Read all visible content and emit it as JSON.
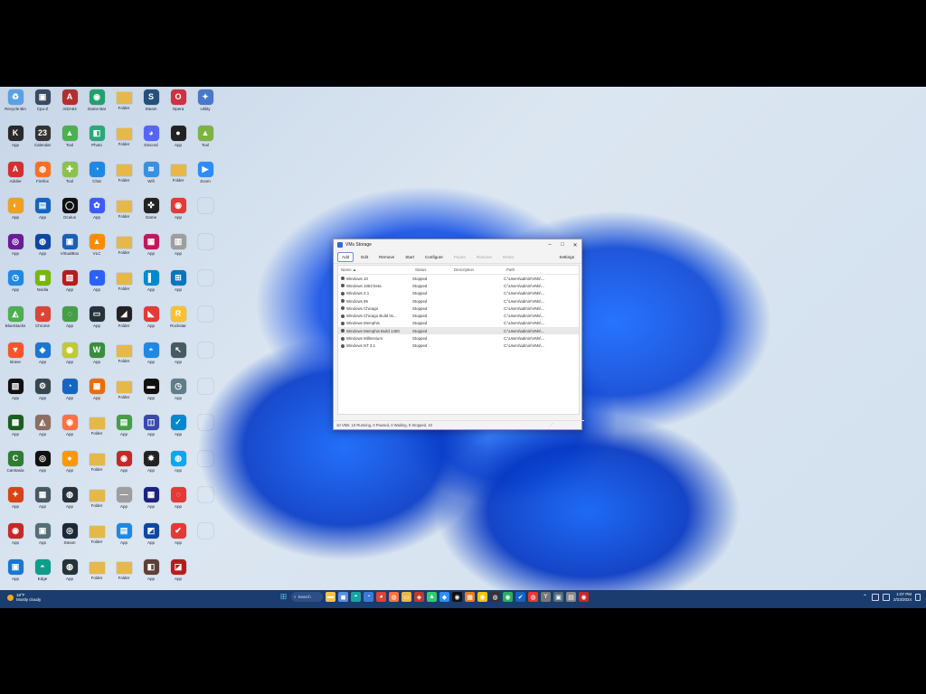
{
  "desktop": {
    "icons": [
      {
        "label": "Recycle Bin",
        "color": "#5aa0e6",
        "glyph": "♻"
      },
      {
        "label": "Cpu-Z",
        "color": "#3a4a60",
        "glyph": "▣"
      },
      {
        "label": "AIDA64",
        "color": "#b03030",
        "glyph": "A"
      },
      {
        "label": "Game Bar",
        "color": "#22a06b",
        "glyph": "◉"
      },
      {
        "label": "Folder",
        "color": "#e6b84a",
        "glyph": ""
      },
      {
        "label": "Steam",
        "color": "#24507a",
        "glyph": "S"
      },
      {
        "label": "Opera",
        "color": "#d03040",
        "glyph": "O"
      },
      {
        "label": "Utility",
        "color": "#4a78c8",
        "glyph": "✦"
      },
      {
        "label": "App",
        "color": "#2a2a2a",
        "glyph": "K"
      },
      {
        "label": "Calendar",
        "color": "#333",
        "glyph": "23"
      },
      {
        "label": "Tool",
        "color": "#4caf50",
        "glyph": "▲"
      },
      {
        "label": "Photo",
        "color": "#2aa878",
        "glyph": "◧"
      },
      {
        "label": "Folder",
        "color": "#e6b84a",
        "glyph": ""
      },
      {
        "label": "Discord",
        "color": "#5865f2",
        "glyph": "◕"
      },
      {
        "label": "App",
        "color": "#222",
        "glyph": "●"
      },
      {
        "label": "Tool",
        "color": "#7cb342",
        "glyph": "▲"
      },
      {
        "label": "Adobe",
        "color": "#d32f2f",
        "glyph": "A"
      },
      {
        "label": "Firefox",
        "color": "#ff6f1f",
        "glyph": "◍"
      },
      {
        "label": "Tool",
        "color": "#8bc34a",
        "glyph": "✚"
      },
      {
        "label": "Chat",
        "color": "#1e88e5",
        "glyph": "◔"
      },
      {
        "label": "Folder",
        "color": "#e6b84a",
        "glyph": ""
      },
      {
        "label": "Wifi",
        "color": "#3a90e0",
        "glyph": "≋"
      },
      {
        "label": "Folder",
        "color": "#e6b84a",
        "glyph": ""
      },
      {
        "label": "Zoom",
        "color": "#2d8cff",
        "glyph": "▶"
      },
      {
        "label": "App",
        "color": "#f0a020",
        "glyph": "◐"
      },
      {
        "label": "App",
        "color": "#1565c0",
        "glyph": "▤"
      },
      {
        "label": "Oculus",
        "color": "#111",
        "glyph": "◯"
      },
      {
        "label": "App",
        "color": "#3d5afe",
        "glyph": "✿"
      },
      {
        "label": "Folder",
        "color": "#e6b84a",
        "glyph": ""
      },
      {
        "label": "Game",
        "color": "#222",
        "glyph": "✜"
      },
      {
        "label": "App",
        "color": "#e53935",
        "glyph": "◉"
      },
      {
        "label": "",
        "color": "rgba(0,0,0,0)",
        "glyph": ""
      },
      {
        "label": "App",
        "color": "#6a1b9a",
        "glyph": "◎"
      },
      {
        "label": "App",
        "color": "#0d47a1",
        "glyph": "◍"
      },
      {
        "label": "VirtualBox",
        "color": "#1a5fb4",
        "glyph": "▣"
      },
      {
        "label": "VLC",
        "color": "#ff8c00",
        "glyph": "▲"
      },
      {
        "label": "Folder",
        "color": "#e6b84a",
        "glyph": ""
      },
      {
        "label": "App",
        "color": "#c2185b",
        "glyph": "▦"
      },
      {
        "label": "App",
        "color": "#9e9e9e",
        "glyph": "▥"
      },
      {
        "label": "",
        "color": "rgba(0,0,0,0)",
        "glyph": ""
      },
      {
        "label": "App",
        "color": "#1e88e5",
        "glyph": "◷"
      },
      {
        "label": "Nvidia",
        "color": "#76b900",
        "glyph": "◼"
      },
      {
        "label": "App",
        "color": "#b71c1c",
        "glyph": "▧"
      },
      {
        "label": "App",
        "color": "#2962ff",
        "glyph": "▪"
      },
      {
        "label": "Folder",
        "color": "#e6b84a",
        "glyph": ""
      },
      {
        "label": "App",
        "color": "#0288d1",
        "glyph": "▌"
      },
      {
        "label": "App",
        "color": "#0277bd",
        "glyph": "⊞"
      },
      {
        "label": "",
        "color": "rgba(0,0,0,0)",
        "glyph": ""
      },
      {
        "label": "BlueStacks",
        "color": "#4caf50",
        "glyph": "◭"
      },
      {
        "label": "Chrome",
        "color": "#db4437",
        "glyph": "◕"
      },
      {
        "label": "App",
        "color": "#43a047",
        "glyph": "◌"
      },
      {
        "label": "App",
        "color": "#263238",
        "glyph": "▭"
      },
      {
        "label": "Folder",
        "color": "#222",
        "glyph": "◢"
      },
      {
        "label": "App",
        "color": "#e53935",
        "glyph": "◣"
      },
      {
        "label": "Rockstar",
        "color": "#fbc02d",
        "glyph": "R"
      },
      {
        "label": "",
        "color": "rgba(0,0,0,0)",
        "glyph": ""
      },
      {
        "label": "Brave",
        "color": "#fb542b",
        "glyph": "▼"
      },
      {
        "label": "App",
        "color": "#1976d2",
        "glyph": "◈"
      },
      {
        "label": "App",
        "color": "#c0ca33",
        "glyph": "◉"
      },
      {
        "label": "App",
        "color": "#388e3c",
        "glyph": "W"
      },
      {
        "label": "Folder",
        "color": "#e6b84a",
        "glyph": ""
      },
      {
        "label": "App",
        "color": "#1e88e5",
        "glyph": "◓"
      },
      {
        "label": "App",
        "color": "#455a64",
        "glyph": "↖"
      },
      {
        "label": "",
        "color": "rgba(0,0,0,0)",
        "glyph": ""
      },
      {
        "label": "App",
        "color": "#111",
        "glyph": "▧"
      },
      {
        "label": "App",
        "color": "#37474f",
        "glyph": "⚙"
      },
      {
        "label": "App",
        "color": "#1565c0",
        "glyph": "◔"
      },
      {
        "label": "App",
        "color": "#ef6c00",
        "glyph": "▩"
      },
      {
        "label": "Folder",
        "color": "#e6b84a",
        "glyph": ""
      },
      {
        "label": "App",
        "color": "#111",
        "glyph": "▬"
      },
      {
        "label": "App",
        "color": "#607d8b",
        "glyph": "◷"
      },
      {
        "label": "",
        "color": "rgba(0,0,0,0)",
        "glyph": ""
      },
      {
        "label": "App",
        "color": "#1b5e20",
        "glyph": "▩"
      },
      {
        "label": "App",
        "color": "#8d6e63",
        "glyph": "◭"
      },
      {
        "label": "App",
        "color": "#ff7043",
        "glyph": "◉"
      },
      {
        "label": "Folder",
        "color": "#e6b84a",
        "glyph": ""
      },
      {
        "label": "App",
        "color": "#43a047",
        "glyph": "▤"
      },
      {
        "label": "App",
        "color": "#3949ab",
        "glyph": "◫"
      },
      {
        "label": "App",
        "color": "#0288d1",
        "glyph": "✓"
      },
      {
        "label": "",
        "color": "rgba(0,0,0,0)",
        "glyph": ""
      },
      {
        "label": "Camtasia",
        "color": "#2e7d32",
        "glyph": "C"
      },
      {
        "label": "App",
        "color": "#111",
        "glyph": "◎"
      },
      {
        "label": "App",
        "color": "#ff9800",
        "glyph": "●"
      },
      {
        "label": "Folder",
        "color": "#e6b84a",
        "glyph": ""
      },
      {
        "label": "App",
        "color": "#c62828",
        "glyph": "◉"
      },
      {
        "label": "App",
        "color": "#222",
        "glyph": "✸"
      },
      {
        "label": "App",
        "color": "#03a9f4",
        "glyph": "◍"
      },
      {
        "label": "",
        "color": "rgba(0,0,0,0)",
        "glyph": ""
      },
      {
        "label": "App",
        "color": "#d84315",
        "glyph": "✦"
      },
      {
        "label": "App",
        "color": "#455a64",
        "glyph": "▦"
      },
      {
        "label": "App",
        "color": "#263238",
        "glyph": "◍"
      },
      {
        "label": "Folder",
        "color": "#e6b84a",
        "glyph": ""
      },
      {
        "label": "App",
        "color": "#9e9e9e",
        "glyph": "—"
      },
      {
        "label": "App",
        "color": "#1a237e",
        "glyph": "▦"
      },
      {
        "label": "App",
        "color": "#e53935",
        "glyph": "◌"
      },
      {
        "label": "",
        "color": "rgba(0,0,0,0)",
        "glyph": ""
      },
      {
        "label": "App",
        "color": "#c62828",
        "glyph": "◉"
      },
      {
        "label": "App",
        "color": "#546e7a",
        "glyph": "▣"
      },
      {
        "label": "Steam",
        "color": "#1b2838",
        "glyph": "◎"
      },
      {
        "label": "Folder",
        "color": "#e6b84a",
        "glyph": ""
      },
      {
        "label": "App",
        "color": "#1e88e5",
        "glyph": "▤"
      },
      {
        "label": "App",
        "color": "#0d47a1",
        "glyph": "◩"
      },
      {
        "label": "App",
        "color": "#e53935",
        "glyph": "✔"
      },
      {
        "label": "",
        "color": "rgba(0,0,0,0)",
        "glyph": ""
      },
      {
        "label": "App",
        "color": "#1976d2",
        "glyph": "▣"
      },
      {
        "label": "Edge",
        "color": "#0f9d8a",
        "glyph": "◓"
      },
      {
        "label": "App",
        "color": "#263238",
        "glyph": "◍"
      },
      {
        "label": "Folder",
        "color": "#e6b84a",
        "glyph": ""
      },
      {
        "label": "Folder",
        "color": "#e6b84a",
        "glyph": ""
      },
      {
        "label": "App",
        "color": "#5d4037",
        "glyph": "◧"
      },
      {
        "label": "App",
        "color": "#b71c1c",
        "glyph": "◪"
      }
    ]
  },
  "window": {
    "title": "VMs Storage",
    "minimize": "–",
    "maximize": "□",
    "close": "✕",
    "toolbar": {
      "add": "Add",
      "edit": "Edit",
      "remove": "Remove",
      "start": "Start",
      "configure": "Configure",
      "pause": "Pause",
      "resume": "Resume",
      "reset": "Reset",
      "settings": "Settings"
    },
    "columns": {
      "name": "Name ▲",
      "status": "Status",
      "description": "Description",
      "path": "Path"
    },
    "rows": [
      {
        "name": "Windows 10",
        "status": "Stopped",
        "path": "C:\\Users\\admin\\VMs\\..."
      },
      {
        "name": "Windows 1063 beta",
        "status": "Stopped",
        "path": "C:\\Users\\admin\\VMs\\..."
      },
      {
        "name": "Windows 3.1",
        "status": "Stopped",
        "path": "C:\\Users\\admin\\VMs\\..."
      },
      {
        "name": "Windows 95",
        "status": "Stopped",
        "path": "C:\\Users\\admin\\VMs\\..."
      },
      {
        "name": "Windows Chicago",
        "status": "Stopped",
        "path": "C:\\Users\\admin\\VMs\\..."
      },
      {
        "name": "Windows Chicago Build 0x...",
        "status": "Stopped",
        "path": "C:\\Users\\admin\\VMs\\..."
      },
      {
        "name": "Windows Memphis",
        "status": "Stopped",
        "path": "C:\\Users\\admin\\VMs\\..."
      },
      {
        "name": "Windows Memphis Build 1400",
        "status": "Stopped",
        "path": "C:\\Users\\admin\\VMs\\...",
        "highlight": true
      },
      {
        "name": "Windows Millennium",
        "status": "Stopped",
        "path": "C:\\Users\\admin\\VMs\\..."
      },
      {
        "name": "Windows NT 3.1",
        "status": "Stopped",
        "path": "C:\\Users\\admin\\VMs\\..."
      }
    ],
    "status_bar": "10 VMs: 10 Running, 0 Paused, 0 Waiting, 0 Stopped, 10",
    "resize_grip": "⋰"
  },
  "taskbar": {
    "weather_temp": "18°F",
    "weather_desc": "Mostly cloudy",
    "search_label": "Search",
    "apps": [
      {
        "name": "files",
        "color": "#f6c343",
        "glyph": "▬"
      },
      {
        "name": "app",
        "color": "#5a8fe0",
        "glyph": "◼"
      },
      {
        "name": "edge",
        "color": "#1aa3a3",
        "glyph": "◓"
      },
      {
        "name": "app",
        "color": "#3a7bd5",
        "glyph": "◔"
      },
      {
        "name": "chrome",
        "color": "#db4437",
        "glyph": "◕"
      },
      {
        "name": "firefox",
        "color": "#ff7139",
        "glyph": "◍"
      },
      {
        "name": "explorer",
        "color": "#e6b84a",
        "glyph": "▭"
      },
      {
        "name": "app",
        "color": "#c0392b",
        "glyph": "◈"
      },
      {
        "name": "app",
        "color": "#2ecc71",
        "glyph": "▲"
      },
      {
        "name": "app",
        "color": "#2d8cff",
        "glyph": "◆"
      },
      {
        "name": "app",
        "color": "#111",
        "glyph": "◉"
      },
      {
        "name": "app",
        "color": "#e67e22",
        "glyph": "▦"
      },
      {
        "name": "app",
        "color": "#f1c40f",
        "glyph": "◉"
      },
      {
        "name": "app",
        "color": "#333",
        "glyph": "◍"
      },
      {
        "name": "app",
        "color": "#27ae60",
        "glyph": "◉"
      },
      {
        "name": "app",
        "color": "#1565c0",
        "glyph": "✔"
      },
      {
        "name": "app",
        "color": "#e53935",
        "glyph": "◍"
      },
      {
        "name": "app",
        "color": "#777",
        "glyph": "Y"
      },
      {
        "name": "app",
        "color": "#546e7a",
        "glyph": "▣"
      },
      {
        "name": "app",
        "color": "#888",
        "glyph": "▤"
      },
      {
        "name": "app",
        "color": "#c62828",
        "glyph": "◉"
      }
    ],
    "time": "1:07 PM",
    "date": "2/23/2024"
  }
}
